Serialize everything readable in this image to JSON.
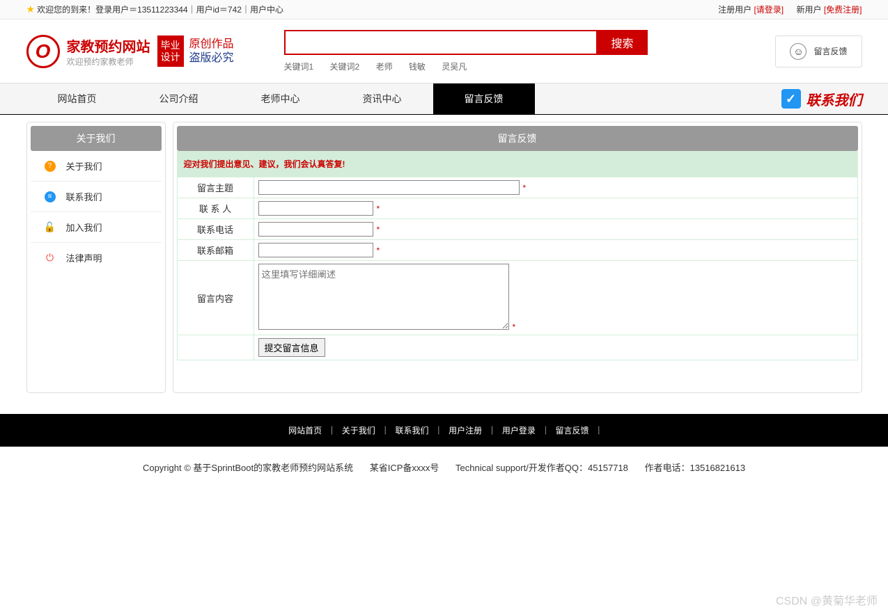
{
  "topbar": {
    "welcome": "欢迎您的到来！登录用户＝13511223344｜用户id＝742｜用户中心",
    "registered_user": "注册用户",
    "please_login": "[请登录]",
    "new_user": "新用户",
    "free_register": "[免费注册]"
  },
  "header": {
    "logo_title": "家教预约网站",
    "logo_sub": "欢迎预约家教老师",
    "badge_line1": "毕业",
    "badge_line2": "设计",
    "script_line1": "原创作品",
    "script_line2": "盗版必究",
    "search_btn": "搜索",
    "keywords": [
      "关键词1",
      "关键词2",
      "老师",
      "钱敏",
      "灵吴凡"
    ],
    "feedback_btn": "留言反馈"
  },
  "nav": {
    "items": [
      "网站首页",
      "公司介绍",
      "老师中心",
      "资讯中心",
      "留言反馈"
    ],
    "contact": "联系我们"
  },
  "sidebar": {
    "title": "关于我们",
    "items": [
      {
        "label": "关于我们",
        "icon_class": "icon-orange",
        "icon_char": "?"
      },
      {
        "label": "联系我们",
        "icon_class": "icon-blue",
        "icon_char": "📋"
      },
      {
        "label": "加入我们",
        "icon_class": "icon-orange",
        "icon_char": "🔒"
      },
      {
        "label": "法律声明",
        "icon_class": "icon-red",
        "icon_char": "⏻"
      }
    ]
  },
  "content": {
    "title": "留言反馈",
    "notice": "迎对我们提出意见、建议，我们会认真答复!",
    "labels": {
      "subject": "留言主题",
      "contact": "联 系 人",
      "phone": "联系电话",
      "email": "联系邮箱",
      "body": "留言内容"
    },
    "textarea_placeholder": "这里填写详细阐述",
    "submit": "提交留言信息"
  },
  "footer": {
    "links": [
      "网站首页",
      "关于我们",
      "联系我们",
      "用户注册",
      "用户登录",
      "留言反馈"
    ],
    "copyright": "Copyright © 基于SprintBoot的家教老师预约网站系统",
    "icp": "某省ICP备xxxx号",
    "support": "Technical support/开发作者QQ：45157718",
    "phone": "作者电话：13516821613"
  },
  "watermark": "CSDN @黄菊华老师"
}
